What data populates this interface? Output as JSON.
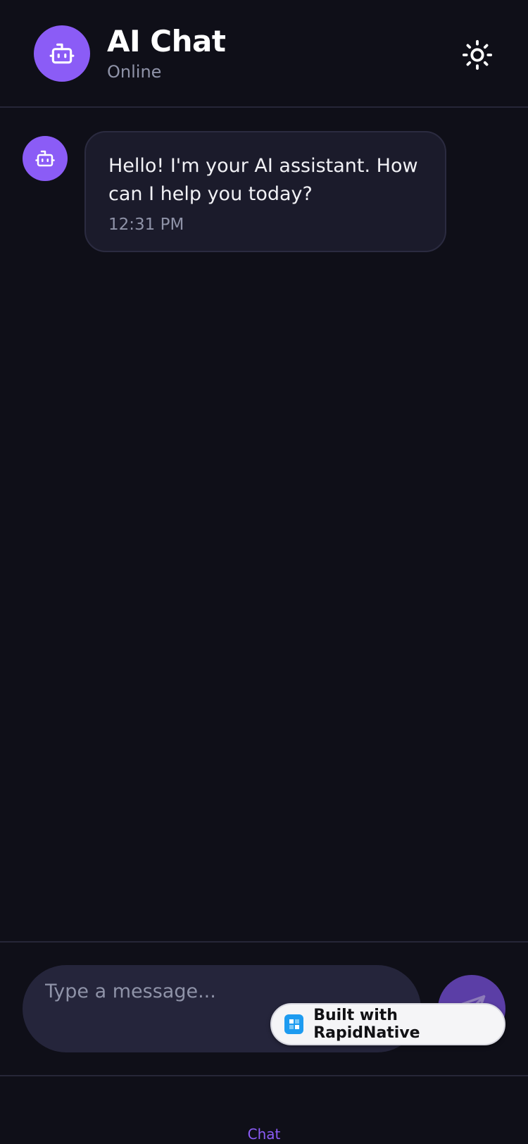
{
  "header": {
    "title": "AI Chat",
    "status": "Online",
    "avatar_icon": "robot-icon",
    "theme_icon": "sun-icon"
  },
  "messages": [
    {
      "sender": "assistant",
      "avatar_icon": "robot-icon",
      "text": "Hello! I'm your AI assistant. How can I help you today?",
      "time": "12:31 PM"
    }
  ],
  "composer": {
    "placeholder": "Type a message...",
    "send_icon": "send-icon"
  },
  "badge": {
    "label": "Built with RapidNative"
  },
  "tabs": [
    {
      "label": "Chat",
      "active": true
    }
  ],
  "colors": {
    "background": "#0f0f18",
    "accent": "#8b5cf6",
    "bubble": "#1b1b2b",
    "input": "#25253b",
    "muted": "#8f93a8"
  }
}
